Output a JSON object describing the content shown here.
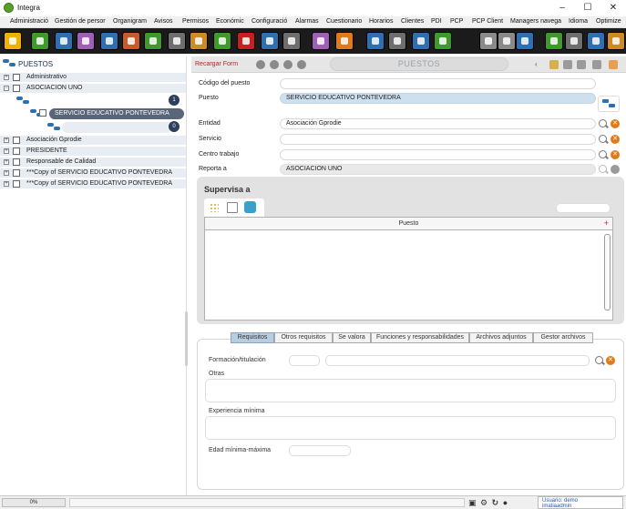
{
  "window": {
    "title": "Integra",
    "minimize": "–",
    "maximize": "☐",
    "close": "✕"
  },
  "menu": [
    "Administració",
    "Gestión de persor",
    "Organigram",
    "Avisos",
    "Permisos",
    "Económic",
    "Configuració",
    "Alarmas",
    "Cuestionario",
    "Horarios",
    "Clientes",
    "PDI",
    "PCP",
    "PCP Client",
    "Managers navega",
    "Idioma",
    "Optimize"
  ],
  "toolbar_colors": [
    "#f0b000",
    "#3f9a2c",
    "#2d6fb0",
    "#a05eb8",
    "#2d6fb0",
    "#c95a2a",
    "#3f9a2c",
    "#6e6e6e",
    "#d08a24",
    "#3f9a2c",
    "#c82020",
    "#2d6fb0",
    "#6e6e6e",
    "#a05eb8",
    "#e07a1a",
    "#2d6fb0",
    "#6e6e6e",
    "#2d6fb0",
    "#3f9a2c",
    "#8a8a8a",
    "#8a8a8a",
    "#2d6fb0",
    "#3f9a2c",
    "#6e6e6e",
    "#2d6fb0",
    "#d08a24"
  ],
  "tree": {
    "root": "PUESTOS",
    "rows": [
      {
        "label": "Administrativo"
      },
      {
        "label": "ASOCIACION UNO"
      }
    ],
    "selected_node": "SERVICIO EDUCATIVO PONTEVEDRA",
    "badges": [
      "1",
      "0"
    ],
    "rows_bottom": [
      {
        "label": "Asociación Gprodie"
      },
      {
        "label": "PRESIDENTE"
      },
      {
        "label": "Responsable de Calidad"
      },
      {
        "label": "***Copy of SERVICIO EDUCATIVO PONTEVEDRA"
      },
      {
        "label": "***Copy of SERVICIO EDUCATIVO PONTEVEDRA"
      }
    ]
  },
  "form": {
    "reload": "Recargar Form",
    "title": "PUESTOS",
    "fields": {
      "codigo": {
        "label": "Código del puesto",
        "value": ""
      },
      "puesto": {
        "label": "Puesto",
        "value": "SERVICIO EDUCATIVO PONTEVEDRA"
      },
      "entidad": {
        "label": "Entidad",
        "value": "Asociación Gprodie"
      },
      "servicio": {
        "label": "Servicio",
        "value": ""
      },
      "centro": {
        "label": "Centro trabajo",
        "value": ""
      },
      "reporta": {
        "label": "Reporta a",
        "value": "ASOCIACION UNO"
      }
    },
    "clear_glyph": "✕"
  },
  "supervisa": {
    "heading": "Supervisa a",
    "column": "Puesto",
    "add": "+"
  },
  "tabs": {
    "items": [
      "Requisitos",
      "Otros requisitos",
      "Se valora",
      "Funciones y responsabilidades",
      "Archivos adjuntos",
      "Gestor archivos"
    ],
    "active": 0,
    "fields": {
      "formacion": "Formación/titulación",
      "otras": "Otras",
      "experiencia": "Experiencia mínima",
      "edad": "Edad mínima-máxima"
    }
  },
  "status": {
    "progress": "0%",
    "user_line1": "Usuario: demo",
    "user_line2": "imatiaadmin"
  }
}
